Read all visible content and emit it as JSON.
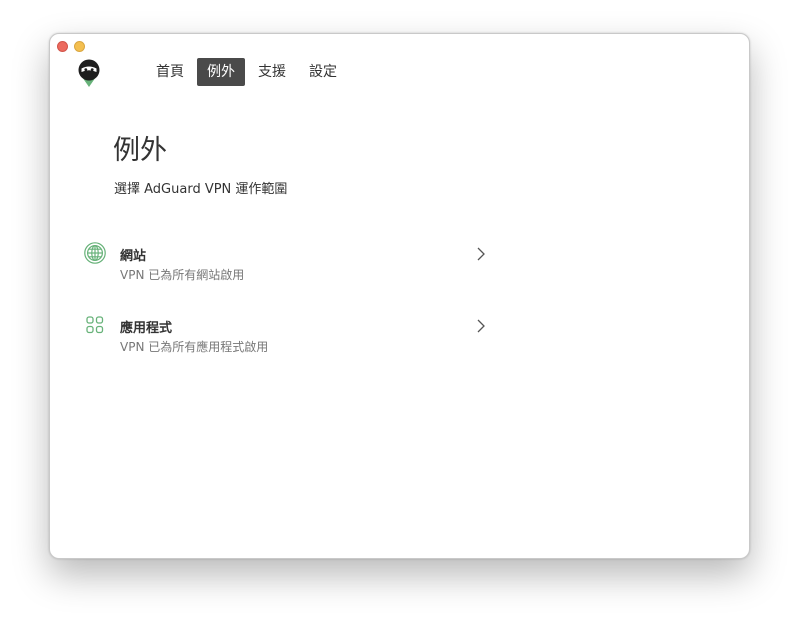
{
  "window": {
    "close_button": "close",
    "minimize_button": "minimize"
  },
  "app": {
    "logo_icon": "adguard-vpn-ninja-logo"
  },
  "nav": {
    "tabs": [
      {
        "label": "首頁",
        "active": false
      },
      {
        "label": "例外",
        "active": true
      },
      {
        "label": "支援",
        "active": false
      },
      {
        "label": "設定",
        "active": false
      }
    ]
  },
  "main": {
    "title": "例外",
    "subtitle": "選擇 AdGuard VPN 運作範圍",
    "items": [
      {
        "icon": "globe-icon",
        "title": "網站",
        "description": "VPN 已為所有網站啟用",
        "chevron": "chevron-right-icon"
      },
      {
        "icon": "apps-grid-icon",
        "title": "應用程式",
        "description": "VPN 已為所有應用程式啟用",
        "chevron": "chevron-right-icon"
      }
    ]
  },
  "colors": {
    "accent_green": "#67b279",
    "active_tab_bg": "#4a4a4a",
    "text_primary": "#333333",
    "text_secondary": "#777777"
  }
}
